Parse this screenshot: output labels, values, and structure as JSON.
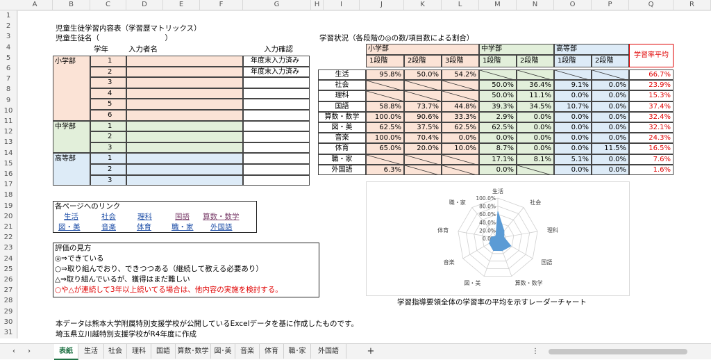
{
  "columns": [
    "A",
    "B",
    "C",
    "D",
    "E",
    "F",
    "G",
    "H",
    "I",
    "J",
    "K",
    "L",
    "M",
    "N",
    "O",
    "P",
    "Q",
    "R"
  ],
  "rows": [
    "1",
    "2",
    "3",
    "4",
    "5",
    "6",
    "7",
    "8",
    "9",
    "10",
    "11",
    "12",
    "13",
    "14",
    "15",
    "16",
    "17",
    "18",
    "19",
    "20",
    "21",
    "22",
    "23",
    "24",
    "25",
    "26",
    "27",
    "28",
    "29",
    "30",
    "31"
  ],
  "header": {
    "title": "児童生徒学習内容表（学習歴マトリックス）",
    "name_label": "児童生徒名（　　　　　　　　　）"
  },
  "left_table": {
    "col_grade": "学年",
    "col_inputter": "入力者名",
    "col_confirm": "入力確認",
    "sections": [
      {
        "label": "小学部",
        "rows": [
          {
            "grade": "1",
            "confirm": "年度末入力済み"
          },
          {
            "grade": "2",
            "confirm": "年度末入力済み"
          },
          {
            "grade": "3",
            "confirm": ""
          },
          {
            "grade": "4",
            "confirm": ""
          },
          {
            "grade": "5",
            "confirm": ""
          },
          {
            "grade": "6",
            "confirm": ""
          }
        ]
      },
      {
        "label": "中学部",
        "rows": [
          {
            "grade": "1",
            "confirm": ""
          },
          {
            "grade": "2",
            "confirm": ""
          },
          {
            "grade": "3",
            "confirm": ""
          }
        ]
      },
      {
        "label": "高等部",
        "rows": [
          {
            "grade": "1",
            "confirm": ""
          },
          {
            "grade": "2",
            "confirm": ""
          },
          {
            "grade": "3",
            "confirm": ""
          }
        ]
      }
    ]
  },
  "links": {
    "title": "各ページへのリンク",
    "items": [
      "生活",
      "社会",
      "理科",
      "国語",
      "算数・数学",
      "図・美",
      "音楽",
      "体育",
      "職・家",
      "外国語"
    ]
  },
  "evaluation": {
    "title": "評価の見方",
    "lines": [
      "◎⇒できている",
      "○⇒取り組んでおり、できつつある（継続して教える必要あり）",
      "△⇒取り組んでいるが、獲得はまだ難しい"
    ],
    "warning": "○や△が連続して3年以上続いてる場合は、他内容の実施を検討する。"
  },
  "status": {
    "title": "学習状況（各段階の◎の数/項目数による割合）",
    "groups": [
      "小学部",
      "中学部",
      "高等部"
    ],
    "stages": [
      "1段階",
      "2段階",
      "3段階",
      "1段階",
      "2段階",
      "1段階",
      "2段階"
    ],
    "avg_header": "学習率平均",
    "subjects": [
      {
        "name": "生活",
        "v": [
          "95.8%",
          "50.0%",
          "54.2%",
          null,
          null,
          null,
          null
        ],
        "avg": "66.7%"
      },
      {
        "name": "社会",
        "v": [
          null,
          null,
          null,
          "50.0%",
          "36.4%",
          "9.1%",
          "0.0%"
        ],
        "avg": "23.9%"
      },
      {
        "name": "理科",
        "v": [
          null,
          null,
          null,
          "50.0%",
          "11.1%",
          "0.0%",
          "0.0%"
        ],
        "avg": "15.3%"
      },
      {
        "name": "国語",
        "v": [
          "58.8%",
          "73.7%",
          "44.8%",
          "39.3%",
          "34.5%",
          "10.7%",
          "0.0%"
        ],
        "avg": "37.4%"
      },
      {
        "name": "算数・数学",
        "v": [
          "100.0%",
          "90.6%",
          "33.3%",
          "2.9%",
          "0.0%",
          "0.0%",
          "0.0%"
        ],
        "avg": "32.4%"
      },
      {
        "name": "図・美",
        "v": [
          "62.5%",
          "37.5%",
          "62.5%",
          "62.5%",
          "0.0%",
          "0.0%",
          "0.0%"
        ],
        "avg": "32.1%"
      },
      {
        "name": "音楽",
        "v": [
          "100.0%",
          "70.4%",
          "0.0%",
          "0.0%",
          "0.0%",
          "0.0%",
          "0.0%"
        ],
        "avg": "24.3%"
      },
      {
        "name": "体育",
        "v": [
          "65.0%",
          "20.0%",
          "10.0%",
          "8.7%",
          "0.0%",
          "0.0%",
          "11.5%"
        ],
        "avg": "16.5%"
      },
      {
        "name": "職・家",
        "v": [
          null,
          null,
          null,
          "17.1%",
          "8.1%",
          "5.1%",
          "0.0%"
        ],
        "avg": "7.6%"
      },
      {
        "name": "外国語",
        "v": [
          "6.3%",
          null,
          null,
          "0.0%",
          null,
          "0.0%",
          "0.0%"
        ],
        "avg": "1.6%"
      }
    ]
  },
  "chart_data": {
    "type": "radar",
    "categories": [
      "生活",
      "社会",
      "理科",
      "国語",
      "算数・数学",
      "図・美",
      "音楽",
      "体育",
      "職・家"
    ],
    "values": [
      66.7,
      23.9,
      15.3,
      37.4,
      32.4,
      32.1,
      24.3,
      16.5,
      7.6
    ],
    "rlim": [
      0,
      100
    ],
    "ticks": [
      "0.0%",
      "20.0%",
      "40.0%",
      "60.0%",
      "80.0%",
      "100.0%"
    ],
    "color": "#5b9bd5",
    "title": "学習指導要領全体の学習率の平均を示すレーダーチャート"
  },
  "footer": {
    "line1": "本データは熊本大学附属特別支援学校が公開しているExcelデータを基に作成したものです。",
    "line2": "埼玉県立川越特別支援学校がR4年度に作成"
  },
  "tabs": [
    "表紙",
    "生活",
    "社会",
    "理科",
    "国語",
    "算数･数学",
    "図･美",
    "音楽",
    "体育",
    "職･家",
    "外国語"
  ],
  "tab_add": "+",
  "nav": {
    "prev": "‹",
    "next": "›",
    "more": "⋮"
  },
  "colors": {
    "elem": "#fbe3d6",
    "jr": "#e2efda",
    "hs": "#ddebf7",
    "accent": "#217346"
  }
}
